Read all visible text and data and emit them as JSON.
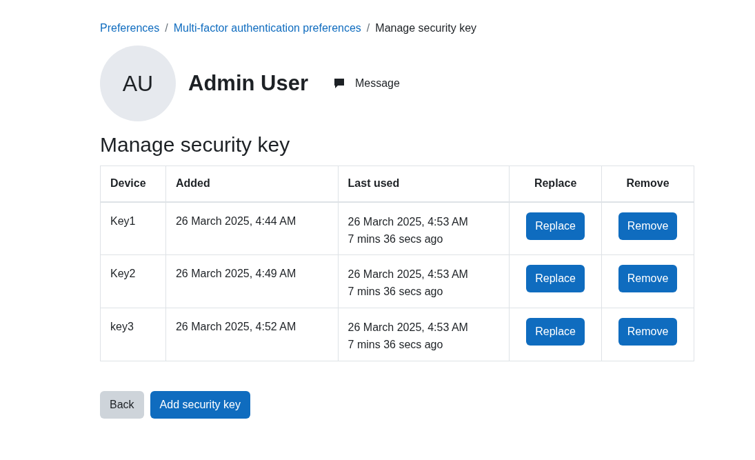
{
  "breadcrumb": [
    {
      "label": "Preferences",
      "kind": "link"
    },
    {
      "label": "Multi-factor authentication preferences",
      "kind": "link",
      "separator": "/"
    },
    {
      "label": "Manage security key",
      "kind": "current",
      "separator": "/"
    }
  ],
  "user": {
    "initials": "AU",
    "name": "Admin User",
    "message": "Message"
  },
  "heading": "Manage security key",
  "table": {
    "columns": [
      "Device",
      "Added",
      "Last used",
      "Replace",
      "Remove"
    ],
    "rows": [
      {
        "device": "Key1",
        "added": "26 March 2025, 4:44 AM",
        "last_used": "26 March 2025, 4:53 AM",
        "ago": "7 mins 36 secs ago",
        "replace": "Replace",
        "remove": "Remove"
      },
      {
        "device": "Key2",
        "added": "26 March 2025, 4:49 AM",
        "last_used": "26 March 2025, 4:53 AM",
        "ago": "7 mins 36 secs ago",
        "replace": "Replace",
        "remove": "Remove"
      },
      {
        "device": "key3",
        "added": "26 March 2025, 4:52 AM",
        "last_used": "26 March 2025, 4:53 AM",
        "ago": "7 mins 36 secs ago",
        "replace": "Replace",
        "remove": "Remove"
      }
    ]
  },
  "buttons": [
    {
      "label": "Back",
      "kind": "secondary"
    },
    {
      "label": "Add security key",
      "kind": "primary"
    }
  ]
}
